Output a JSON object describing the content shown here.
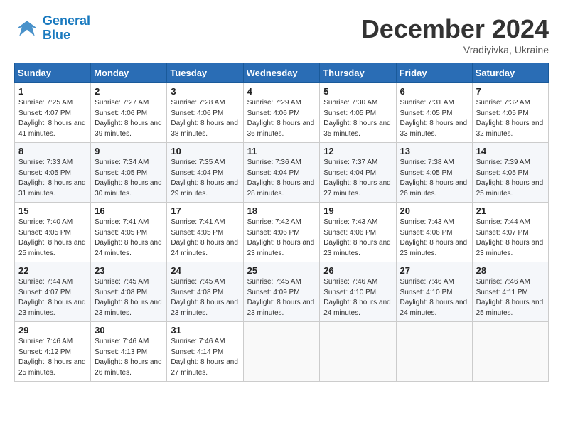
{
  "header": {
    "logo_line1": "General",
    "logo_line2": "Blue",
    "month": "December 2024",
    "location": "Vradiyivka, Ukraine"
  },
  "days_of_week": [
    "Sunday",
    "Monday",
    "Tuesday",
    "Wednesday",
    "Thursday",
    "Friday",
    "Saturday"
  ],
  "weeks": [
    [
      {
        "day": 1,
        "sunrise": "7:25 AM",
        "sunset": "4:07 PM",
        "daylight": "8 hours and 41 minutes."
      },
      {
        "day": 2,
        "sunrise": "7:27 AM",
        "sunset": "4:06 PM",
        "daylight": "8 hours and 39 minutes."
      },
      {
        "day": 3,
        "sunrise": "7:28 AM",
        "sunset": "4:06 PM",
        "daylight": "8 hours and 38 minutes."
      },
      {
        "day": 4,
        "sunrise": "7:29 AM",
        "sunset": "4:06 PM",
        "daylight": "8 hours and 36 minutes."
      },
      {
        "day": 5,
        "sunrise": "7:30 AM",
        "sunset": "4:05 PM",
        "daylight": "8 hours and 35 minutes."
      },
      {
        "day": 6,
        "sunrise": "7:31 AM",
        "sunset": "4:05 PM",
        "daylight": "8 hours and 33 minutes."
      },
      {
        "day": 7,
        "sunrise": "7:32 AM",
        "sunset": "4:05 PM",
        "daylight": "8 hours and 32 minutes."
      }
    ],
    [
      {
        "day": 8,
        "sunrise": "7:33 AM",
        "sunset": "4:05 PM",
        "daylight": "8 hours and 31 minutes."
      },
      {
        "day": 9,
        "sunrise": "7:34 AM",
        "sunset": "4:05 PM",
        "daylight": "8 hours and 30 minutes."
      },
      {
        "day": 10,
        "sunrise": "7:35 AM",
        "sunset": "4:04 PM",
        "daylight": "8 hours and 29 minutes."
      },
      {
        "day": 11,
        "sunrise": "7:36 AM",
        "sunset": "4:04 PM",
        "daylight": "8 hours and 28 minutes."
      },
      {
        "day": 12,
        "sunrise": "7:37 AM",
        "sunset": "4:04 PM",
        "daylight": "8 hours and 27 minutes."
      },
      {
        "day": 13,
        "sunrise": "7:38 AM",
        "sunset": "4:05 PM",
        "daylight": "8 hours and 26 minutes."
      },
      {
        "day": 14,
        "sunrise": "7:39 AM",
        "sunset": "4:05 PM",
        "daylight": "8 hours and 25 minutes."
      }
    ],
    [
      {
        "day": 15,
        "sunrise": "7:40 AM",
        "sunset": "4:05 PM",
        "daylight": "8 hours and 25 minutes."
      },
      {
        "day": 16,
        "sunrise": "7:41 AM",
        "sunset": "4:05 PM",
        "daylight": "8 hours and 24 minutes."
      },
      {
        "day": 17,
        "sunrise": "7:41 AM",
        "sunset": "4:05 PM",
        "daylight": "8 hours and 24 minutes."
      },
      {
        "day": 18,
        "sunrise": "7:42 AM",
        "sunset": "4:06 PM",
        "daylight": "8 hours and 23 minutes."
      },
      {
        "day": 19,
        "sunrise": "7:43 AM",
        "sunset": "4:06 PM",
        "daylight": "8 hours and 23 minutes."
      },
      {
        "day": 20,
        "sunrise": "7:43 AM",
        "sunset": "4:06 PM",
        "daylight": "8 hours and 23 minutes."
      },
      {
        "day": 21,
        "sunrise": "7:44 AM",
        "sunset": "4:07 PM",
        "daylight": "8 hours and 23 minutes."
      }
    ],
    [
      {
        "day": 22,
        "sunrise": "7:44 AM",
        "sunset": "4:07 PM",
        "daylight": "8 hours and 23 minutes."
      },
      {
        "day": 23,
        "sunrise": "7:45 AM",
        "sunset": "4:08 PM",
        "daylight": "8 hours and 23 minutes."
      },
      {
        "day": 24,
        "sunrise": "7:45 AM",
        "sunset": "4:08 PM",
        "daylight": "8 hours and 23 minutes."
      },
      {
        "day": 25,
        "sunrise": "7:45 AM",
        "sunset": "4:09 PM",
        "daylight": "8 hours and 23 minutes."
      },
      {
        "day": 26,
        "sunrise": "7:46 AM",
        "sunset": "4:10 PM",
        "daylight": "8 hours and 24 minutes."
      },
      {
        "day": 27,
        "sunrise": "7:46 AM",
        "sunset": "4:10 PM",
        "daylight": "8 hours and 24 minutes."
      },
      {
        "day": 28,
        "sunrise": "7:46 AM",
        "sunset": "4:11 PM",
        "daylight": "8 hours and 25 minutes."
      }
    ],
    [
      {
        "day": 29,
        "sunrise": "7:46 AM",
        "sunset": "4:12 PM",
        "daylight": "8 hours and 25 minutes."
      },
      {
        "day": 30,
        "sunrise": "7:46 AM",
        "sunset": "4:13 PM",
        "daylight": "8 hours and 26 minutes."
      },
      {
        "day": 31,
        "sunrise": "7:46 AM",
        "sunset": "4:14 PM",
        "daylight": "8 hours and 27 minutes."
      },
      null,
      null,
      null,
      null
    ]
  ]
}
